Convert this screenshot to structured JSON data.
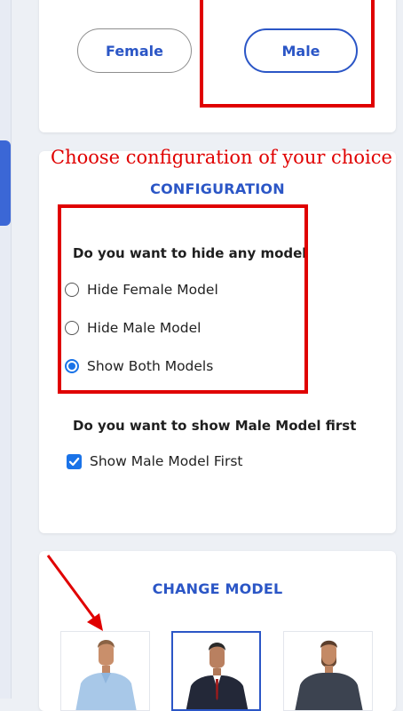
{
  "gender": {
    "options": [
      "Female",
      "Male"
    ],
    "selected": "Male"
  },
  "annotation_text": "Choose configuration of your choice",
  "configuration": {
    "title": "CONFIGURATION",
    "hide_question": "Do you want to hide any model",
    "hide_options": [
      "Hide Female Model",
      "Hide Male Model",
      "Show Both Models"
    ],
    "hide_selected": "Show Both Models",
    "order_question": "Do you want to show Male Model first",
    "order_option": "Show Male Model First",
    "order_checked": true
  },
  "change_model": {
    "title": "CHANGE MODEL",
    "models": [
      {
        "icon": "model-light-blue-shirt"
      },
      {
        "icon": "model-dark-suit",
        "selected": true
      },
      {
        "icon": "model-grey-tshirt"
      }
    ]
  },
  "colors": {
    "accent": "#2b56c6",
    "annotation_red": "#e00000",
    "control_blue": "#1a73e8"
  }
}
